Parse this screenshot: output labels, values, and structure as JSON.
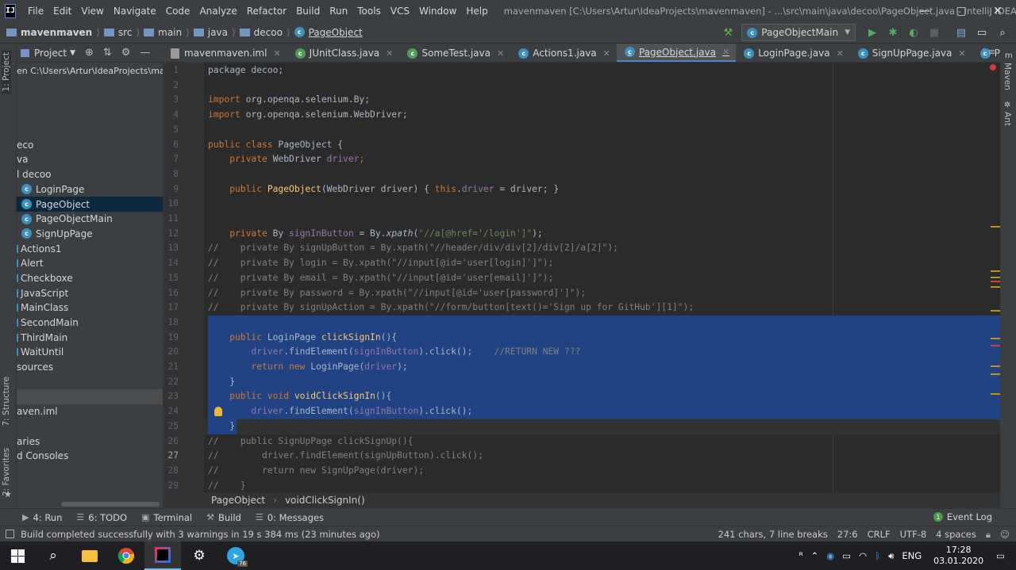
{
  "app": {
    "logo_text": "IJ",
    "window_title": "mavenmaven [C:\\Users\\Artur\\IdeaProjects\\mavenmaven] - ...\\src\\main\\java\\decoo\\PageObject.java - IntelliJ IDEA"
  },
  "menu": [
    "File",
    "Edit",
    "View",
    "Navigate",
    "Code",
    "Analyze",
    "Refactor",
    "Build",
    "Run",
    "Tools",
    "VCS",
    "Window",
    "Help"
  ],
  "window_controls": {
    "minimize": "—",
    "maximize": "▢",
    "close": "✕"
  },
  "nav": {
    "crumbs": [
      "mavenmaven",
      "src",
      "main",
      "java",
      "decoo",
      "PageObject"
    ],
    "run_config": "PageObjectMain",
    "run_config_arrow": "▼"
  },
  "left_stripe": {
    "project_tab": "1: Project",
    "structure_tab": "7: Structure",
    "favorites_tab": "2: Favorites"
  },
  "right_stripe": {
    "maven_tab": "Maven",
    "ant_tab": "Ant"
  },
  "project_panel": {
    "title": "Project",
    "tree": [
      {
        "label": "en  C:\\Users\\Artur\\IdeaProjects\\maven",
        "indent": 0,
        "icon": "none"
      },
      {
        "label": "",
        "indent": 0,
        "icon": "none"
      },
      {
        "label": "",
        "indent": 0,
        "icon": "none"
      },
      {
        "label": "",
        "indent": 0,
        "icon": "none"
      },
      {
        "label": "",
        "indent": 0,
        "icon": "none"
      },
      {
        "label": "eco",
        "indent": 0,
        "icon": "none"
      },
      {
        "label": "va",
        "indent": 0,
        "icon": "none"
      },
      {
        "label": "l decoo",
        "indent": 0,
        "icon": "none"
      },
      {
        "label": "LoginPage",
        "indent": 6,
        "icon": "class",
        "selected": false
      },
      {
        "label": "PageObject",
        "indent": 6,
        "icon": "class",
        "selected": true
      },
      {
        "label": "PageObjectMain",
        "indent": 6,
        "icon": "class",
        "selected": false
      },
      {
        "label": "SignUpPage",
        "indent": 6,
        "icon": "class",
        "selected": false
      },
      {
        "label": "Actions1",
        "indent": 0,
        "icon": "marker"
      },
      {
        "label": "Alert",
        "indent": 0,
        "icon": "marker"
      },
      {
        "label": "Checkboxe",
        "indent": 0,
        "icon": "marker"
      },
      {
        "label": "JavaScript",
        "indent": 0,
        "icon": "marker"
      },
      {
        "label": "MainClass",
        "indent": 0,
        "icon": "marker"
      },
      {
        "label": "SecondMain",
        "indent": 0,
        "icon": "marker"
      },
      {
        "label": "ThirdMain",
        "indent": 0,
        "icon": "marker"
      },
      {
        "label": "WaitUntil",
        "indent": 0,
        "icon": "marker"
      },
      {
        "label": "sources",
        "indent": 0,
        "icon": "none"
      },
      {
        "label": "",
        "indent": 0,
        "icon": "none"
      },
      {
        "label": "",
        "indent": 0,
        "icon": "none",
        "highlight": true
      },
      {
        "label": "aven.iml",
        "indent": 0,
        "icon": "none"
      },
      {
        "label": "",
        "indent": 0,
        "icon": "none"
      },
      {
        "label": "aries",
        "indent": 0,
        "icon": "none"
      },
      {
        "label": "d Consoles",
        "indent": 0,
        "icon": "none"
      }
    ]
  },
  "tabs": [
    {
      "label": "mavenmaven.iml",
      "icon": "file",
      "active": false
    },
    {
      "label": "JUnitClass.java",
      "icon": "class-green",
      "active": false
    },
    {
      "label": "SomeTest.java",
      "icon": "class-green",
      "active": false
    },
    {
      "label": "Actions1.java",
      "icon": "class",
      "active": false
    },
    {
      "label": "PageObject.java",
      "icon": "class",
      "active": true
    },
    {
      "label": "LoginPage.java",
      "icon": "class",
      "active": false
    },
    {
      "label": "SignUpPage.java",
      "icon": "class",
      "active": false
    },
    {
      "label": "PageObjectMain.java",
      "icon": "class",
      "active": false
    }
  ],
  "tabs_overflow": "⋮≡",
  "editor": {
    "lines": [
      [
        {
          "t": "package decoo;",
          "c": ""
        }
      ],
      [],
      [
        {
          "t": "import ",
          "c": "kw"
        },
        {
          "t": "org.openqa.selenium.By;",
          "c": ""
        }
      ],
      [
        {
          "t": "import ",
          "c": "kw"
        },
        {
          "t": "org.openqa.selenium.WebDriver;",
          "c": ""
        }
      ],
      [],
      [
        {
          "t": "public class ",
          "c": "kw"
        },
        {
          "t": "PageObject {",
          "c": ""
        }
      ],
      [
        {
          "t": "    private ",
          "c": "kw"
        },
        {
          "t": "WebDriver ",
          "c": ""
        },
        {
          "t": "driver",
          "c": "fld"
        },
        {
          "t": ";",
          "c": "kw"
        }
      ],
      [],
      [
        {
          "t": "    public ",
          "c": "kw"
        },
        {
          "t": "PageObject",
          "c": "fn"
        },
        {
          "t": "(WebDriver driver) { ",
          "c": ""
        },
        {
          "t": "this",
          "c": "kw"
        },
        {
          "t": ".",
          "c": ""
        },
        {
          "t": "driver",
          "c": "fld"
        },
        {
          "t": " = driver; }",
          "c": ""
        }
      ],
      [],
      [],
      [
        {
          "t": "    private ",
          "c": "kw"
        },
        {
          "t": "By ",
          "c": ""
        },
        {
          "t": "signInButton",
          "c": "fld"
        },
        {
          "t": " = By.",
          "c": ""
        },
        {
          "t": "xpath",
          "c": "it"
        },
        {
          "t": "(",
          "c": ""
        },
        {
          "t": "\"//a[@href='/login']\"",
          "c": "str"
        },
        {
          "t": ");",
          "c": ""
        }
      ],
      [
        {
          "t": "//    private By signUpButton = By.xpath(\"//header/div/div[2]/div[2]/a[2]\");",
          "c": "cm"
        }
      ],
      [
        {
          "t": "//    private By login = By.xpath(\"//input[@id='user[login]']\");",
          "c": "cm"
        }
      ],
      [
        {
          "t": "//    private By email = By.xpath(\"//input[@id='user[email]']\");",
          "c": "cm"
        }
      ],
      [
        {
          "t": "//    private By password = By.xpath(\"//input[@id='user[password]']\");",
          "c": "cm"
        }
      ],
      [
        {
          "t": "//    private By signUpAction = By.xpath(\"//form/button[text()='Sign up for GitHub'][1]\");",
          "c": "cm"
        }
      ],
      [],
      [
        {
          "t": "    public ",
          "c": "kw"
        },
        {
          "t": "LoginPage ",
          "c": ""
        },
        {
          "t": "clickSignIn",
          "c": "fn"
        },
        {
          "t": "(){",
          "c": ""
        }
      ],
      [
        {
          "t": "        driver",
          "c": "fld"
        },
        {
          "t": ".findElement(",
          "c": ""
        },
        {
          "t": "signInButton",
          "c": "fld"
        },
        {
          "t": ").click();    ",
          "c": ""
        },
        {
          "t": "//RETURN NEW ???",
          "c": "cm"
        }
      ],
      [
        {
          "t": "        return new ",
          "c": "kw"
        },
        {
          "t": "LoginPage(",
          "c": ""
        },
        {
          "t": "driver",
          "c": "fld"
        },
        {
          "t": ");",
          "c": ""
        }
      ],
      [
        {
          "t": "    }",
          "c": ""
        }
      ],
      [
        {
          "t": "    public void ",
          "c": "kw"
        },
        {
          "t": "voidClickSignIn",
          "c": "fn"
        },
        {
          "t": "(){",
          "c": ""
        }
      ],
      [
        {
          "t": "        driver",
          "c": "fld"
        },
        {
          "t": ".findElement(",
          "c": ""
        },
        {
          "t": "signInButton",
          "c": "fld"
        },
        {
          "t": ").click();",
          "c": ""
        }
      ],
      [
        {
          "t": "    }",
          "c": ""
        }
      ],
      [
        {
          "t": "//    public SignUpPage clickSignUp(){",
          "c": "cm"
        }
      ],
      [
        {
          "t": "//        driver.findElement(signUpButton).click();",
          "c": "cm"
        }
      ],
      [
        {
          "t": "//        return new SignUpPage(driver);",
          "c": "cm"
        }
      ],
      [
        {
          "t": "//    }",
          "c": "cm"
        }
      ]
    ]
  },
  "editor_breadcrumb": {
    "class_name": "PageObject",
    "method_name": "voidClickSignIn()",
    "sep": "›"
  },
  "tool_windows": [
    {
      "icon": "▶",
      "label": "4: Run"
    },
    {
      "icon": "☰",
      "label": "6: TODO"
    },
    {
      "icon": "▣",
      "label": "Terminal"
    },
    {
      "icon": "⚒",
      "label": "Build"
    },
    {
      "icon": "☰",
      "label": "0: Messages"
    }
  ],
  "event_log": {
    "icon": "●",
    "label": "Event Log",
    "count": "1"
  },
  "status": {
    "message": "Build completed successfully with 3 warnings in 19 s 384 ms (23 minutes ago)",
    "chars": "241 chars, 7 line breaks",
    "position": "27:6",
    "line_sep": "CRLF",
    "encoding": "UTF-8",
    "indent": "4 spaces"
  },
  "taskbar": {
    "lang": "ENG",
    "time": "17:28",
    "date": "03.01.2020",
    "telegram_badge": "76"
  },
  "colors": {
    "accent": "#4a88c7",
    "selection": "#214283",
    "bg": "#2b2b2b",
    "panel": "#3c3f41",
    "keyword": "#cc7832",
    "string": "#6a8759",
    "field": "#9876aa",
    "method": "#ffc66d",
    "comment": "#808080"
  }
}
